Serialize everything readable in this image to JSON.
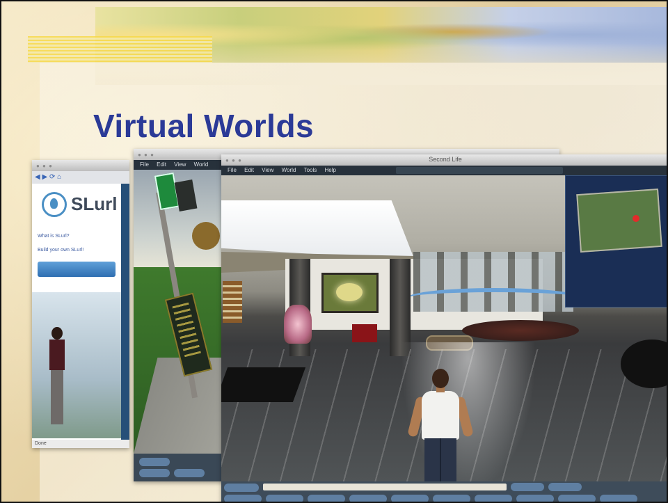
{
  "slide": {
    "title": "Virtual Worlds"
  },
  "browser": {
    "logo_text": "SLurl",
    "link_1": "What is SLurl?",
    "link_2": "Build your own SLurl!",
    "status": "Done"
  },
  "sl_back": {
    "menu": [
      "File",
      "Edit",
      "View",
      "World"
    ]
  },
  "sl_front": {
    "window_title": "Second Life",
    "menu": [
      "File",
      "Edit",
      "View",
      "World",
      "Tools",
      "Help"
    ]
  },
  "colors": {
    "title": "#2b3a97",
    "background": "#efe0b8"
  }
}
